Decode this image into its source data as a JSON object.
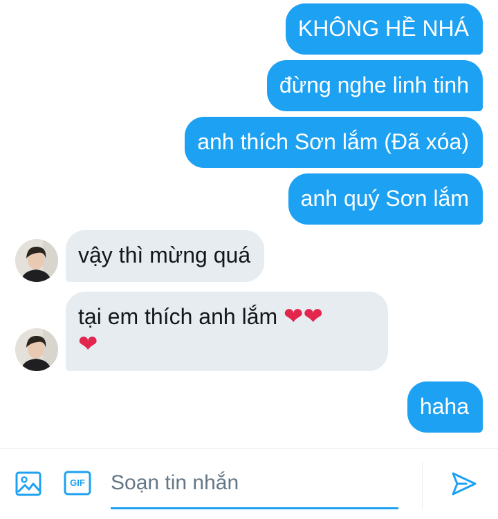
{
  "messages": [
    {
      "id": "m1",
      "direction": "outgoing",
      "text": "KHÔNG HỀ NHÁ"
    },
    {
      "id": "m2",
      "direction": "outgoing",
      "text": "đừng nghe linh tinh"
    },
    {
      "id": "m3",
      "direction": "outgoing",
      "text": "anh thích Sơn lắm (Đã xóa)"
    },
    {
      "id": "m4",
      "direction": "outgoing",
      "text": "anh quý Sơn lắm"
    },
    {
      "id": "m5",
      "direction": "incoming",
      "text": "vậy thì mừng quá"
    },
    {
      "id": "m6",
      "direction": "incoming",
      "text": "tại em thích anh lắm",
      "emoji": "❤❤",
      "emoji_line2": "❤"
    },
    {
      "id": "m7",
      "direction": "outgoing",
      "text": "haha"
    }
  ],
  "composer": {
    "placeholder": "Soạn tin nhắn",
    "gif_label": "GIF",
    "icons": [
      "image-icon",
      "gif-icon",
      "send-icon"
    ]
  },
  "colors": {
    "accent": "#1da1f2",
    "incoming_bubble": "#e6ecf0",
    "heart": "#e2264d"
  }
}
